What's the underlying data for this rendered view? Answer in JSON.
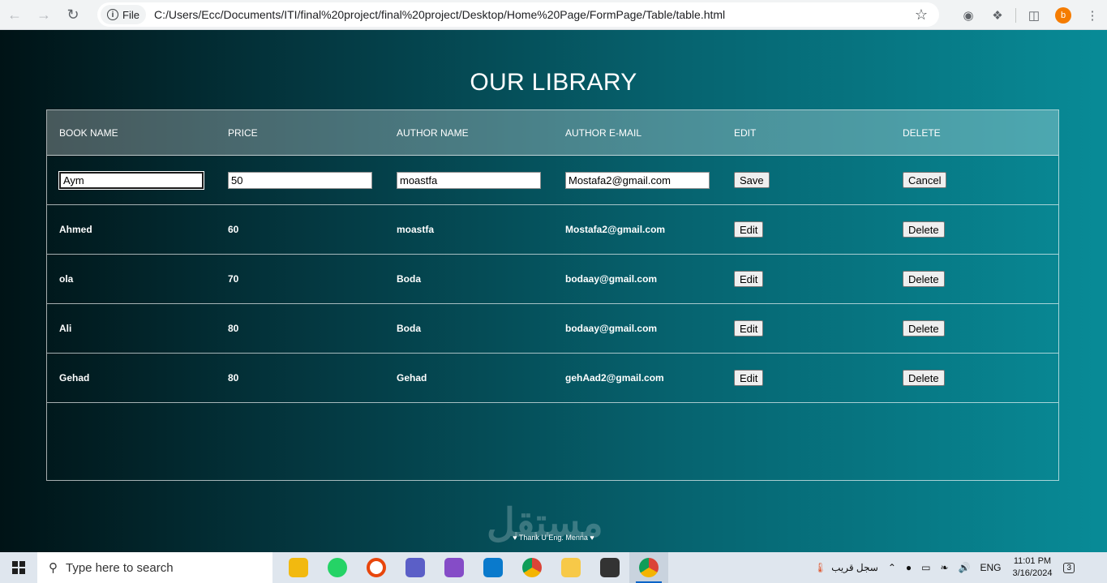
{
  "browser": {
    "site_chip": "File",
    "url": "C:/Users/Ecc/Documents/ITI/final%20project/final%20project/Desktop/Home%20Page/FormPage/Table/table.html",
    "profile_initial": "b"
  },
  "page": {
    "title": "OUR LIBRARY",
    "headers": [
      "BOOK NAME",
      "PRICE",
      "AUTHOR NAME",
      "AUTHOR E-MAIL",
      "EDIT",
      "DELETE"
    ],
    "edit_row": {
      "book_name": "Aym",
      "price": "50",
      "author_name": "moastfa",
      "author_email": "Mostafa2@gmail.com",
      "save_label": "Save",
      "cancel_label": "Cancel"
    },
    "rows": [
      {
        "book_name": "Ahmed",
        "price": "60",
        "author_name": "moastfa",
        "author_email": "Mostafa2@gmail.com",
        "edit_label": "Edit",
        "delete_label": "Delete"
      },
      {
        "book_name": "ola",
        "price": "70",
        "author_name": "Boda",
        "author_email": "bodaay@gmail.com",
        "edit_label": "Edit",
        "delete_label": "Delete"
      },
      {
        "book_name": "Ali",
        "price": "80",
        "author_name": "Boda",
        "author_email": "bodaay@gmail.com",
        "edit_label": "Edit",
        "delete_label": "Delete"
      },
      {
        "book_name": "Gehad",
        "price": "80",
        "author_name": "Gehad",
        "author_email": "gehAad2@gmail.com",
        "edit_label": "Edit",
        "delete_label": "Delete"
      }
    ],
    "footer": "♥ Thank U Eng. Menna ♥",
    "watermark": "مستقل"
  },
  "taskbar": {
    "search_placeholder": "Type here to search",
    "weather_text": "سجل قريب",
    "language": "ENG",
    "time": "11:01 PM",
    "date": "3/16/2024",
    "notification_count": "3"
  }
}
